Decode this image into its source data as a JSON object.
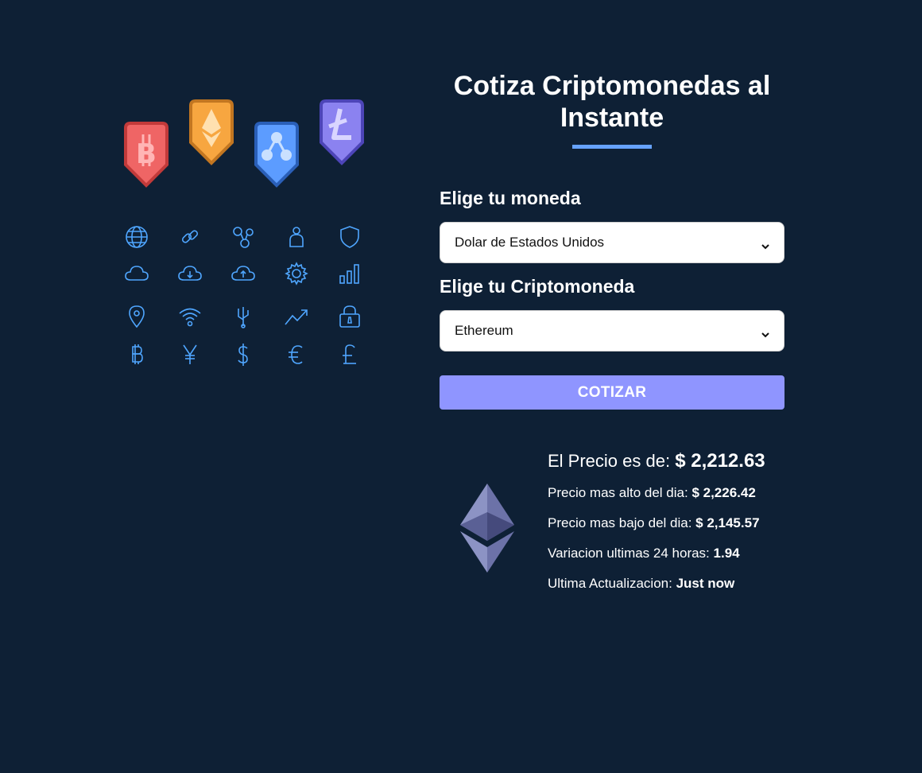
{
  "header": {
    "title": "Cotiza Criptomonedas al Instante"
  },
  "form": {
    "currency_label": "Elige tu moneda",
    "currency_selected": "Dolar de Estados Unidos",
    "crypto_label": "Elige tu Criptomoneda",
    "crypto_selected": "Ethereum",
    "submit_label": "COTIZAR"
  },
  "result": {
    "price_label": "El Precio es de:",
    "price_value": "$ 2,212.63",
    "high_label": "Precio mas alto del dia:",
    "high_value": "$ 2,226.42",
    "low_label": "Precio mas bajo del dia:",
    "low_value": "$ 2,145.57",
    "change_label": "Variacion ultimas 24 horas:",
    "change_value": "1.94",
    "updated_label": "Ultima Actualizacion:",
    "updated_value": "Just now"
  },
  "hero": {
    "shields": [
      "bitcoin-shield-icon",
      "ethereum-shield-icon",
      "ripple-shield-icon",
      "litecoin-shield-icon"
    ],
    "icons": [
      "globe-icon",
      "link-icon",
      "network-icon",
      "user-icon",
      "shield-icon",
      "cloud-icon",
      "cloud-download-icon",
      "cloud-upload-icon",
      "gear-icon",
      "bar-chart-icon",
      "location-pin-icon",
      "wifi-icon",
      "usb-icon",
      "trend-up-icon",
      "lock-icon",
      "bitcoin-icon",
      "yen-icon",
      "dollar-icon",
      "euro-icon",
      "pound-icon"
    ]
  },
  "colors": {
    "background": "#0e2035",
    "accent": "#66a2fe",
    "button": "#8f95ff",
    "icon_stroke": "#4fa6ff"
  }
}
